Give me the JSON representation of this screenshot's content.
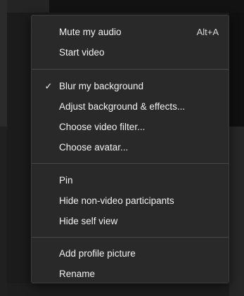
{
  "menu": {
    "sections": [
      {
        "items": [
          {
            "label": "Mute my audio",
            "shortcut": "Alt+A"
          },
          {
            "label": "Start video"
          }
        ]
      },
      {
        "items": [
          {
            "label": "Blur my background",
            "checked": true,
            "check_icon": "✓"
          },
          {
            "label": "Adjust background & effects..."
          },
          {
            "label": "Choose video filter..."
          },
          {
            "label": "Choose avatar..."
          }
        ]
      },
      {
        "items": [
          {
            "label": "Pin"
          },
          {
            "label": "Hide non-video participants"
          },
          {
            "label": "Hide self view"
          }
        ]
      },
      {
        "items": [
          {
            "label": "Add profile picture"
          },
          {
            "label": "Rename"
          }
        ]
      }
    ]
  },
  "colors": {
    "menu_background": "#292929",
    "text": "#f2f2f2",
    "divider": "#474747"
  }
}
